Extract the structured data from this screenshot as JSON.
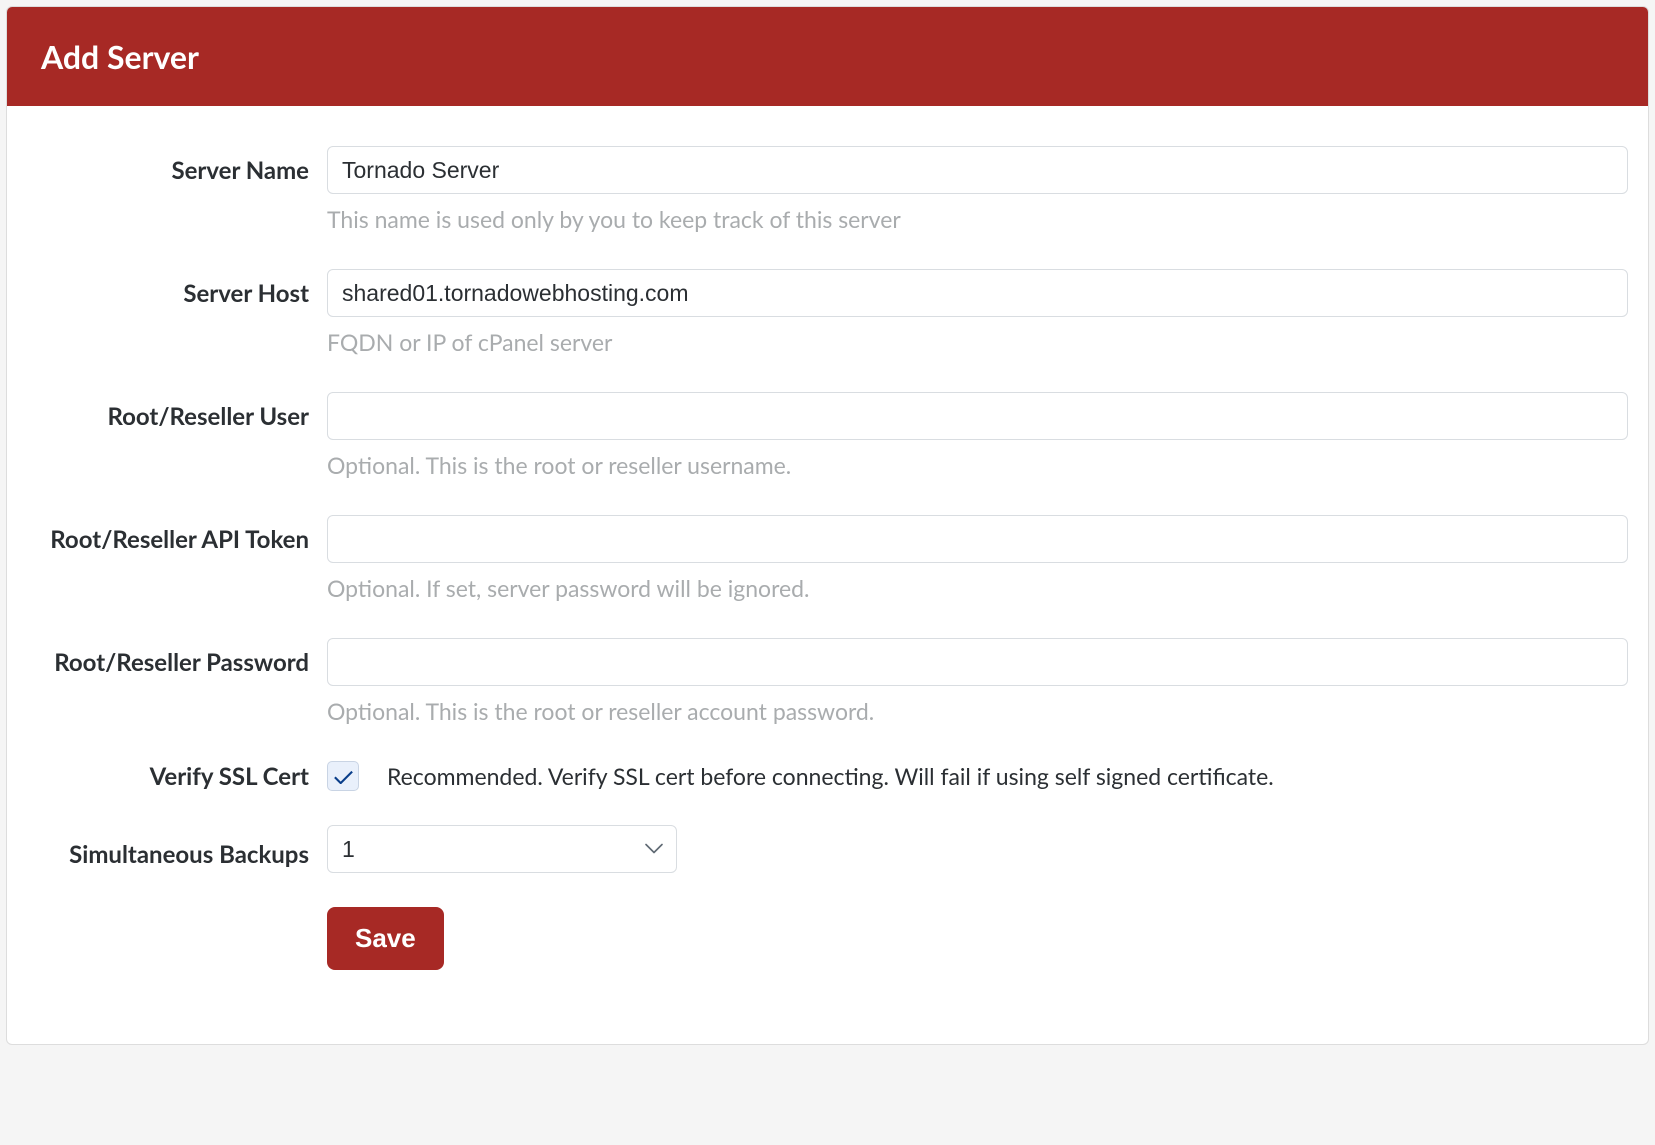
{
  "header": {
    "title": "Add Server"
  },
  "form": {
    "server_name": {
      "label": "Server Name",
      "value": "Tornado Server",
      "help": "This name is used only by you to keep track of this server"
    },
    "server_host": {
      "label": "Server Host",
      "value": "shared01.tornadowebhosting.com",
      "help": "FQDN or IP of cPanel server"
    },
    "root_user": {
      "label": "Root/Reseller User",
      "value": "",
      "help": "Optional. This is the root or reseller username."
    },
    "api_token": {
      "label": "Root/Reseller API Token",
      "value": "",
      "help": "Optional. If set, server password will be ignored."
    },
    "password": {
      "label": "Root/Reseller Password",
      "value": "",
      "help": "Optional. This is the root or reseller account password."
    },
    "verify_ssl": {
      "label": "Verify SSL Cert",
      "checked": true,
      "description": "Recommended. Verify SSL cert before connecting. Will fail if using self signed certificate."
    },
    "simultaneous": {
      "label": "Simultaneous Backups",
      "value": "1"
    },
    "save_label": "Save"
  }
}
